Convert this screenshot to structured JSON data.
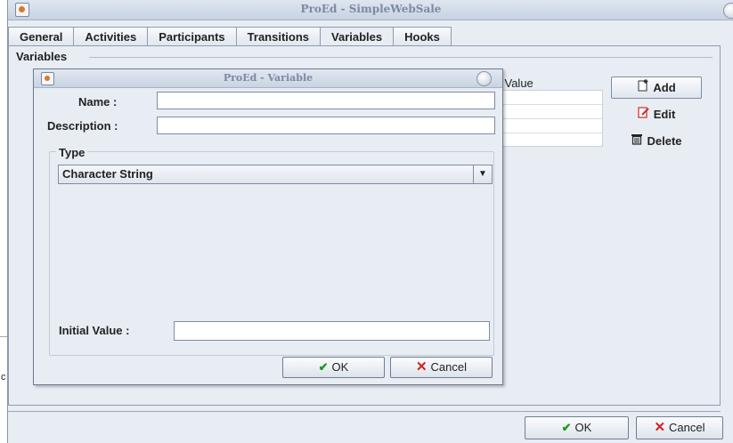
{
  "window": {
    "title": "ProEd - SimpleWebSale"
  },
  "tabs": [
    {
      "label": "General",
      "selected": false
    },
    {
      "label": "Activities",
      "selected": false
    },
    {
      "label": "Participants",
      "selected": false
    },
    {
      "label": "Transitions",
      "selected": false
    },
    {
      "label": "Variables",
      "selected": true
    },
    {
      "label": "Hooks",
      "selected": false
    }
  ],
  "variables_panel": {
    "group_label": "Variables",
    "column_header": "l Value",
    "buttons": {
      "add": "Add",
      "edit": "Edit",
      "delete": "Delete"
    }
  },
  "footer": {
    "ok": "OK",
    "cancel": "Cancel"
  },
  "left_edge_mark": "c",
  "dialog": {
    "title": "ProEd - Variable",
    "name_label": "Name :",
    "name_value": "",
    "description_label": "Description :",
    "description_value": "",
    "type_label": "Type",
    "type_selected": "Character String",
    "initial_value_label": "Initial Value :",
    "initial_value": "",
    "ok": "OK",
    "cancel": "Cancel"
  },
  "colors": {
    "ok_check": "#1a9a1a",
    "cancel_x": "#d42020",
    "edit_icon": "#cc2a2a",
    "panel_bg": "#e8edf4"
  },
  "icons": {
    "add": "add-document-icon",
    "edit": "edit-pencil-icon",
    "delete": "trash-icon",
    "ok": "checkmark-icon",
    "cancel": "x-icon"
  }
}
